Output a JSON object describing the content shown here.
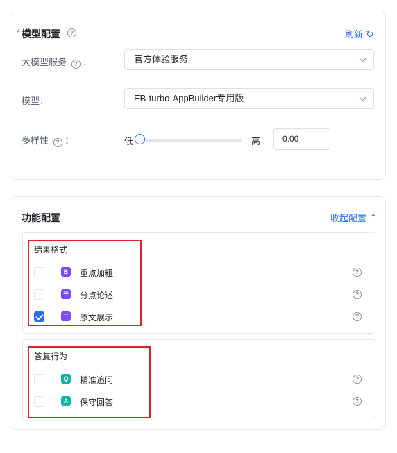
{
  "model_config": {
    "required_mark": "*",
    "title": "模型配置",
    "refresh_label": "刷新",
    "fields": {
      "service_label": "大模型服务",
      "service_colon": "：",
      "service_value": "官方体验服务",
      "model_label": "模型：",
      "model_value": "EB-turbo-AppBuilder专用版",
      "diversity_label": "多样性",
      "diversity_colon": "：",
      "diversity_low": "低",
      "diversity_high": "高",
      "diversity_value": "0.00"
    }
  },
  "function_config": {
    "title": "功能配置",
    "collapse_label": "收起配置",
    "groups": [
      {
        "title": "结果格式",
        "options": [
          {
            "label": "重点加粗",
            "icon_text": "B",
            "checked": false,
            "icon_color": "#7b4cf5"
          },
          {
            "label": "分点论述",
            "icon_text": "☰",
            "checked": false,
            "icon_color": "#7b4cf5"
          },
          {
            "label": "原文展示",
            "icon_text": "☰",
            "checked": true,
            "icon_color": "#7b4cf5"
          }
        ]
      },
      {
        "title": "答复行为",
        "options": [
          {
            "label": "精准追问",
            "icon_text": "Q",
            "checked": false,
            "icon_color": "#13b3a7"
          },
          {
            "label": "保守回答",
            "icon_text": "A",
            "checked": false,
            "icon_color": "#13b3a7"
          }
        ]
      }
    ]
  },
  "help_glyph": "?",
  "colors": {
    "accent": "#2f6bff",
    "required": "#e5484d",
    "highlight_border": "#d9252b"
  }
}
